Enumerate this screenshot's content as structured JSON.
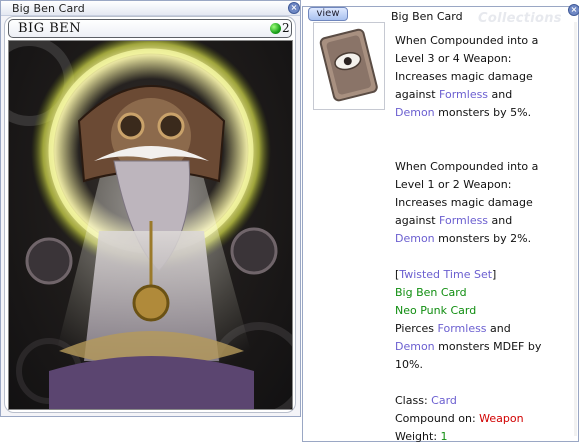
{
  "card_window": {
    "title": "Big Ben Card",
    "card_name": "BIG BEN",
    "slots": "2"
  },
  "desc_window": {
    "view_label": "view",
    "title": "Big Ben Card",
    "watermark": "Collections",
    "paragraph1": [
      "When Compounded into a",
      "Level 3 or 4 Weapon:",
      "Increases magic damage"
    ],
    "p1_against": "against",
    "p1_formless": "Formless",
    "p1_and": "and",
    "p1_demon": "Demon",
    "p1_end": "monsters by 5%.",
    "paragraph2": [
      "When Compounded into a",
      "Level 1 or 2 Weapon:",
      "Increases magic damage"
    ],
    "p2_against": "against",
    "p2_formless": "Formless",
    "p2_and": "and",
    "p2_demon": "Demon",
    "p2_end": "monsters by 2%.",
    "set_open": "[",
    "set_name": "Twisted Time Set",
    "set_close": "]",
    "set_items": [
      "Big Ben Card",
      "Neo Punk Card"
    ],
    "pierce_text": "Pierces",
    "pierce_formless": "Formless",
    "pierce_and": "and",
    "pierce_demon": "Demon",
    "pierce_end": "monsters MDEF by",
    "pierce_pct": "10%.",
    "class_label": "Class:",
    "class_value": "Card",
    "compound_label": "Compound on:",
    "compound_value": "Weapon",
    "weight_label": "Weight:",
    "weight_value": "1"
  },
  "colors": {
    "link_blue": "#6b5fd0",
    "item_green": "#118e11",
    "compound_red": "#d10000",
    "frame_blue": "#9aa7c4"
  },
  "icons": [
    "close-icon",
    "slot-indicator-icon",
    "card-thumbnail-icon"
  ]
}
